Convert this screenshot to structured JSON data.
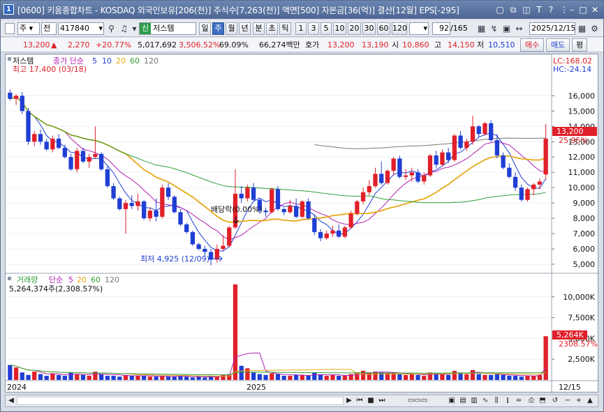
{
  "window": {
    "icon_label": "1",
    "title": "[0600] 키움종합차트 - KOSDAQ 외국인보유[206(천)] 주식수[7,263(천)] 액면[500] 자본금[36(억)] 결산[12월] EPS[-295]"
  },
  "toolbar": {
    "market": "주",
    "exchange": "전",
    "code": "417840",
    "stock_name": "저스템",
    "period_buttons": [
      "일",
      "주",
      "월",
      "년",
      "분",
      "초",
      "틱"
    ],
    "period_selected": "주",
    "minute_buttons": [
      "1",
      "3",
      "5",
      "10",
      "20",
      "30",
      "60",
      "120"
    ],
    "range_value": "92",
    "range_total": "/165",
    "date": "2025/12/15",
    "new_badge": "신"
  },
  "quote": {
    "price": "13,200",
    "change": "2,270",
    "change_pct": "+20.77%",
    "volume": "5,017,692",
    "volume_pct": "3,506.52%",
    "turnover": "69.09%",
    "amount": "66,274백만",
    "hoga_label": "호가",
    "ask": "13,200",
    "bid": "13,190",
    "open_label": "시",
    "open": "10,860",
    "high_label": "고",
    "high": "14,150",
    "low_label": "저",
    "low": "10,510",
    "buy_label": "매수",
    "sell_label": "매도",
    "avg_label": "평"
  },
  "price_pane": {
    "name_label": "저스템",
    "legend": [
      "종가 단순",
      "5",
      "10",
      "20",
      "60",
      "120"
    ],
    "lc_label": "LC:168.02",
    "hc_label": "HC:-24.14",
    "high_note": "최고 17,400 (03/18)",
    "low_note": "최저 4,925 (12/09)",
    "dividend_note": "배당락(0.00%)",
    "price_tag": "13,200",
    "pct_tag": "25.95%",
    "y_ticks": [
      "16,000",
      "15,000",
      "14,000",
      "13,000",
      "12,000",
      "11,000",
      "10,000",
      "9,000",
      "8,000",
      "7,000",
      "6,000",
      "5,000"
    ]
  },
  "volume_pane": {
    "legend": [
      "거래량",
      "단순",
      "5",
      "20",
      "60",
      "120"
    ],
    "current_volume": "5,264,374주(2,308.57%)",
    "vol_tag": "5,264K",
    "vol_pct_tag": "2308.57%",
    "y_ticks": [
      "10,000K",
      "7,500K",
      "5,000K",
      "2,500K"
    ]
  },
  "x_axis": {
    "labels": [
      "2024",
      "2025"
    ],
    "last_date": "12/15"
  },
  "colors": {
    "up": "#e0202a",
    "down": "#1f3ed4",
    "ma5": "#1f3ed4",
    "ma10": "#b01fb0",
    "ma20": "#e6a817",
    "ma60": "#2f9e3a",
    "ma120": "#777777"
  },
  "chart_data": {
    "type": "candlestick",
    "series": [
      {
        "name": "저스템",
        "values": [
          [
            16200,
            16400,
            15700,
            15800
          ],
          [
            15800,
            16100,
            15400,
            16000
          ],
          [
            16000,
            16250,
            14800,
            15000
          ],
          [
            15000,
            15200,
            12800,
            13000
          ],
          [
            13000,
            13700,
            12700,
            13500
          ],
          [
            13500,
            13800,
            12800,
            13000
          ],
          [
            13000,
            13200,
            12400,
            12500
          ],
          [
            12500,
            13400,
            12300,
            13200
          ],
          [
            13200,
            13500,
            12500,
            12600
          ],
          [
            12600,
            12800,
            11900,
            12000
          ],
          [
            12000,
            12200,
            11100,
            11200
          ],
          [
            11200,
            12600,
            11000,
            12400
          ],
          [
            12400,
            12600,
            11600,
            11700
          ],
          [
            11700,
            12200,
            11300,
            12000
          ],
          [
            12000,
            14000,
            11900,
            12200
          ],
          [
            12200,
            12300,
            11100,
            11200
          ],
          [
            11200,
            11400,
            10000,
            10100
          ],
          [
            10100,
            10300,
            9200,
            9300
          ],
          [
            9300,
            9400,
            8500,
            8600
          ],
          [
            8600,
            9200,
            7000,
            9000
          ],
          [
            9000,
            9500,
            8600,
            8800
          ],
          [
            8800,
            9600,
            8500,
            9100
          ],
          [
            9100,
            9200,
            7900,
            8000
          ],
          [
            8000,
            8700,
            7800,
            8500
          ],
          [
            8500,
            9300,
            7800,
            8100
          ],
          [
            8100,
            10200,
            8000,
            10000
          ],
          [
            10000,
            10300,
            9200,
            9400
          ],
          [
            9400,
            9500,
            8300,
            8400
          ],
          [
            8400,
            8600,
            7500,
            7600
          ],
          [
            7600,
            7700,
            7000,
            7100
          ],
          [
            7100,
            7200,
            6200,
            6300
          ],
          [
            6300,
            6400,
            5900,
            6000
          ],
          [
            6000,
            6200,
            5500,
            5800
          ],
          [
            5800,
            6000,
            4925,
            5300
          ],
          [
            5300,
            6300,
            5100,
            6000
          ],
          [
            6000,
            6900,
            5900,
            6200
          ],
          [
            6200,
            7500,
            6100,
            7400
          ],
          [
            7400,
            11200,
            7300,
            9600
          ],
          [
            9600,
            10100,
            9000,
            9300
          ],
          [
            9300,
            10200,
            9100,
            10000
          ],
          [
            10000,
            10300,
            9100,
            9200
          ],
          [
            9200,
            9300,
            8300,
            8500
          ],
          [
            8500,
            8700,
            8100,
            8400
          ],
          [
            8400,
            10000,
            8300,
            9900
          ],
          [
            9900,
            10100,
            8500,
            8600
          ],
          [
            8600,
            8700,
            8200,
            8400
          ],
          [
            8400,
            9200,
            8300,
            8800
          ],
          [
            8800,
            9300,
            8000,
            8100
          ],
          [
            8100,
            9200,
            8000,
            9100
          ],
          [
            9100,
            9300,
            7900,
            8000
          ],
          [
            8000,
            8200,
            6900,
            7100
          ],
          [
            7100,
            7300,
            6500,
            6700
          ],
          [
            6700,
            7200,
            6600,
            7000
          ],
          [
            7000,
            7500,
            6800,
            7200
          ],
          [
            7200,
            7600,
            6700,
            6800
          ],
          [
            6800,
            7500,
            6700,
            7400
          ],
          [
            7400,
            8500,
            7300,
            8300
          ],
          [
            8300,
            9200,
            8200,
            9100
          ],
          [
            9100,
            10000,
            8900,
            9700
          ],
          [
            9700,
            10500,
            9500,
            10100
          ],
          [
            10100,
            11300,
            10000,
            10900
          ],
          [
            10900,
            11700,
            10200,
            10300
          ],
          [
            10300,
            11200,
            10200,
            11100
          ],
          [
            11100,
            12000,
            10800,
            11900
          ],
          [
            11900,
            12100,
            10600,
            10700
          ],
          [
            10700,
            11200,
            10500,
            10800
          ],
          [
            10800,
            11300,
            10400,
            11000
          ],
          [
            11000,
            11200,
            10300,
            10400
          ],
          [
            10400,
            11000,
            10200,
            10800
          ],
          [
            10800,
            12200,
            10700,
            12100
          ],
          [
            12100,
            12400,
            11300,
            11500
          ],
          [
            11500,
            12500,
            11400,
            12300
          ],
          [
            12300,
            12600,
            11600,
            11800
          ],
          [
            11800,
            13500,
            11700,
            13400
          ],
          [
            13400,
            13700,
            12500,
            12600
          ],
          [
            12600,
            13200,
            12400,
            13000
          ],
          [
            13000,
            14700,
            12800,
            14000
          ],
          [
            14000,
            14100,
            13300,
            13500
          ],
          [
            13500,
            14300,
            13400,
            14200
          ],
          [
            14200,
            14400,
            13000,
            13100
          ],
          [
            13100,
            13500,
            11900,
            12100
          ],
          [
            12100,
            12300,
            11200,
            11300
          ],
          [
            11300,
            11600,
            10600,
            10700
          ],
          [
            10700,
            11000,
            9800,
            10000
          ],
          [
            10000,
            10200,
            9100,
            9200
          ],
          [
            9200,
            10000,
            9100,
            9900
          ],
          [
            9900,
            10300,
            9500,
            10200
          ],
          [
            10200,
            10600,
            9900,
            10400
          ],
          [
            10860,
            14150,
            10510,
            13200
          ]
        ]
      }
    ],
    "volume": [
      1800,
      1500,
      900,
      600,
      1000,
      700,
      500,
      800,
      600,
      500,
      900,
      700,
      600,
      500,
      1000,
      700,
      500,
      500,
      400,
      600,
      500,
      500,
      500,
      400,
      400,
      500,
      400,
      400,
      500,
      400,
      300,
      400,
      300,
      500,
      400,
      600,
      700,
      11500,
      1700,
      1400,
      900,
      700,
      600,
      800,
      700,
      500,
      500,
      600,
      600,
      500,
      900,
      600,
      500,
      600,
      500,
      500,
      700,
      900,
      1100,
      900,
      1000,
      900,
      800,
      900,
      700,
      600,
      700,
      600,
      500,
      900,
      800,
      700,
      600,
      1100,
      900,
      700,
      1200,
      700,
      600,
      600,
      700,
      600,
      500,
      500,
      400,
      500,
      500,
      600,
      5264
    ],
    "y_range": [
      4500,
      17700
    ],
    "volume_range": [
      0,
      12500
    ]
  }
}
